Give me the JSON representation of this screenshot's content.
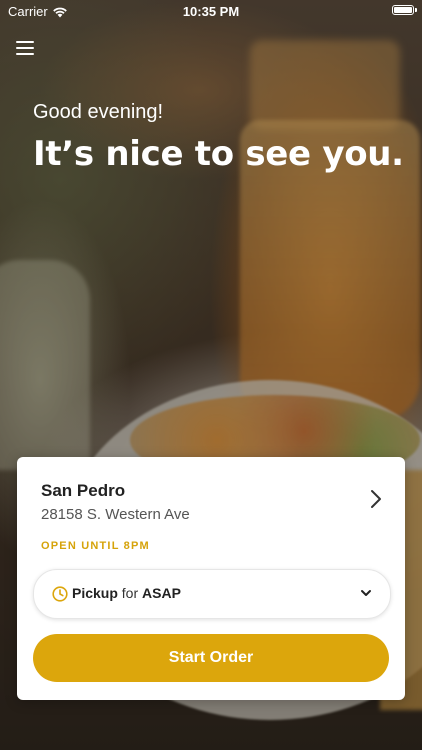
{
  "status_bar": {
    "carrier": "Carrier",
    "time": "10:35 PM",
    "icons": [
      "wifi-icon",
      "battery-icon"
    ]
  },
  "header": {
    "menu_icon": "hamburger-menu-icon",
    "greeting": "Good evening!",
    "headline": "It’s nice to see you."
  },
  "store": {
    "name": "San Pedro",
    "address": "28158 S. Western Ave",
    "hours": "OPEN UNTIL 8PM",
    "icon": "chevron-right-icon"
  },
  "pickup": {
    "mode": "Pickup",
    "connector": "for",
    "time": "ASAP",
    "icon": "clock-icon",
    "dropdown_icon": "chevron-down-icon"
  },
  "actions": {
    "start_order": "Start Order"
  },
  "colors": {
    "accent": "#dca60c",
    "hours_text": "#d6a30a",
    "card_bg": "#ffffff"
  }
}
